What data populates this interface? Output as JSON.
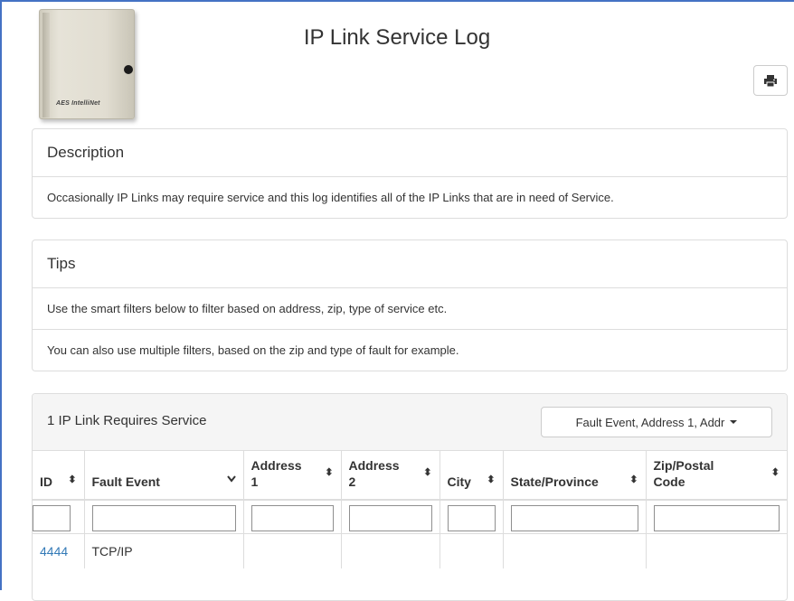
{
  "page": {
    "title": "IP Link Service Log",
    "device_brand": "AES IntelliNet",
    "print_icon": "printer-icon"
  },
  "description": {
    "heading": "Description",
    "text": "Occasionally IP Links may require service and this log identifies all of the IP Links that are in need of Service."
  },
  "tips": {
    "heading": "Tips",
    "items": [
      "Use the smart filters below to filter based on address, zip, type of service etc.",
      "You can also use multiple filters, based on the zip and type of fault for example."
    ]
  },
  "service_table": {
    "title": "1 IP Link Requires Service",
    "columns_dropdown": "Fault Event, Address 1, Addr",
    "columns": [
      {
        "label": "ID",
        "icon": "sort-icon"
      },
      {
        "label": "Fault Event",
        "icon": "chevron-down-icon"
      },
      {
        "label": "Address 1",
        "icon": "sort-icon"
      },
      {
        "label": "Address 2",
        "icon": "sort-icon"
      },
      {
        "label": "City",
        "icon": "sort-icon"
      },
      {
        "label": "State/Province",
        "icon": "sort-icon"
      },
      {
        "label": "Zip/Postal Code",
        "icon": "sort-icon"
      }
    ],
    "rows": [
      {
        "id": "4444",
        "fault_event": "TCP/IP",
        "address1": "",
        "address2": "",
        "city": "",
        "state": "",
        "zip": ""
      }
    ]
  },
  "colors": {
    "link": "#337ab7",
    "border": "#dddddd",
    "frame": "#4472c4"
  }
}
